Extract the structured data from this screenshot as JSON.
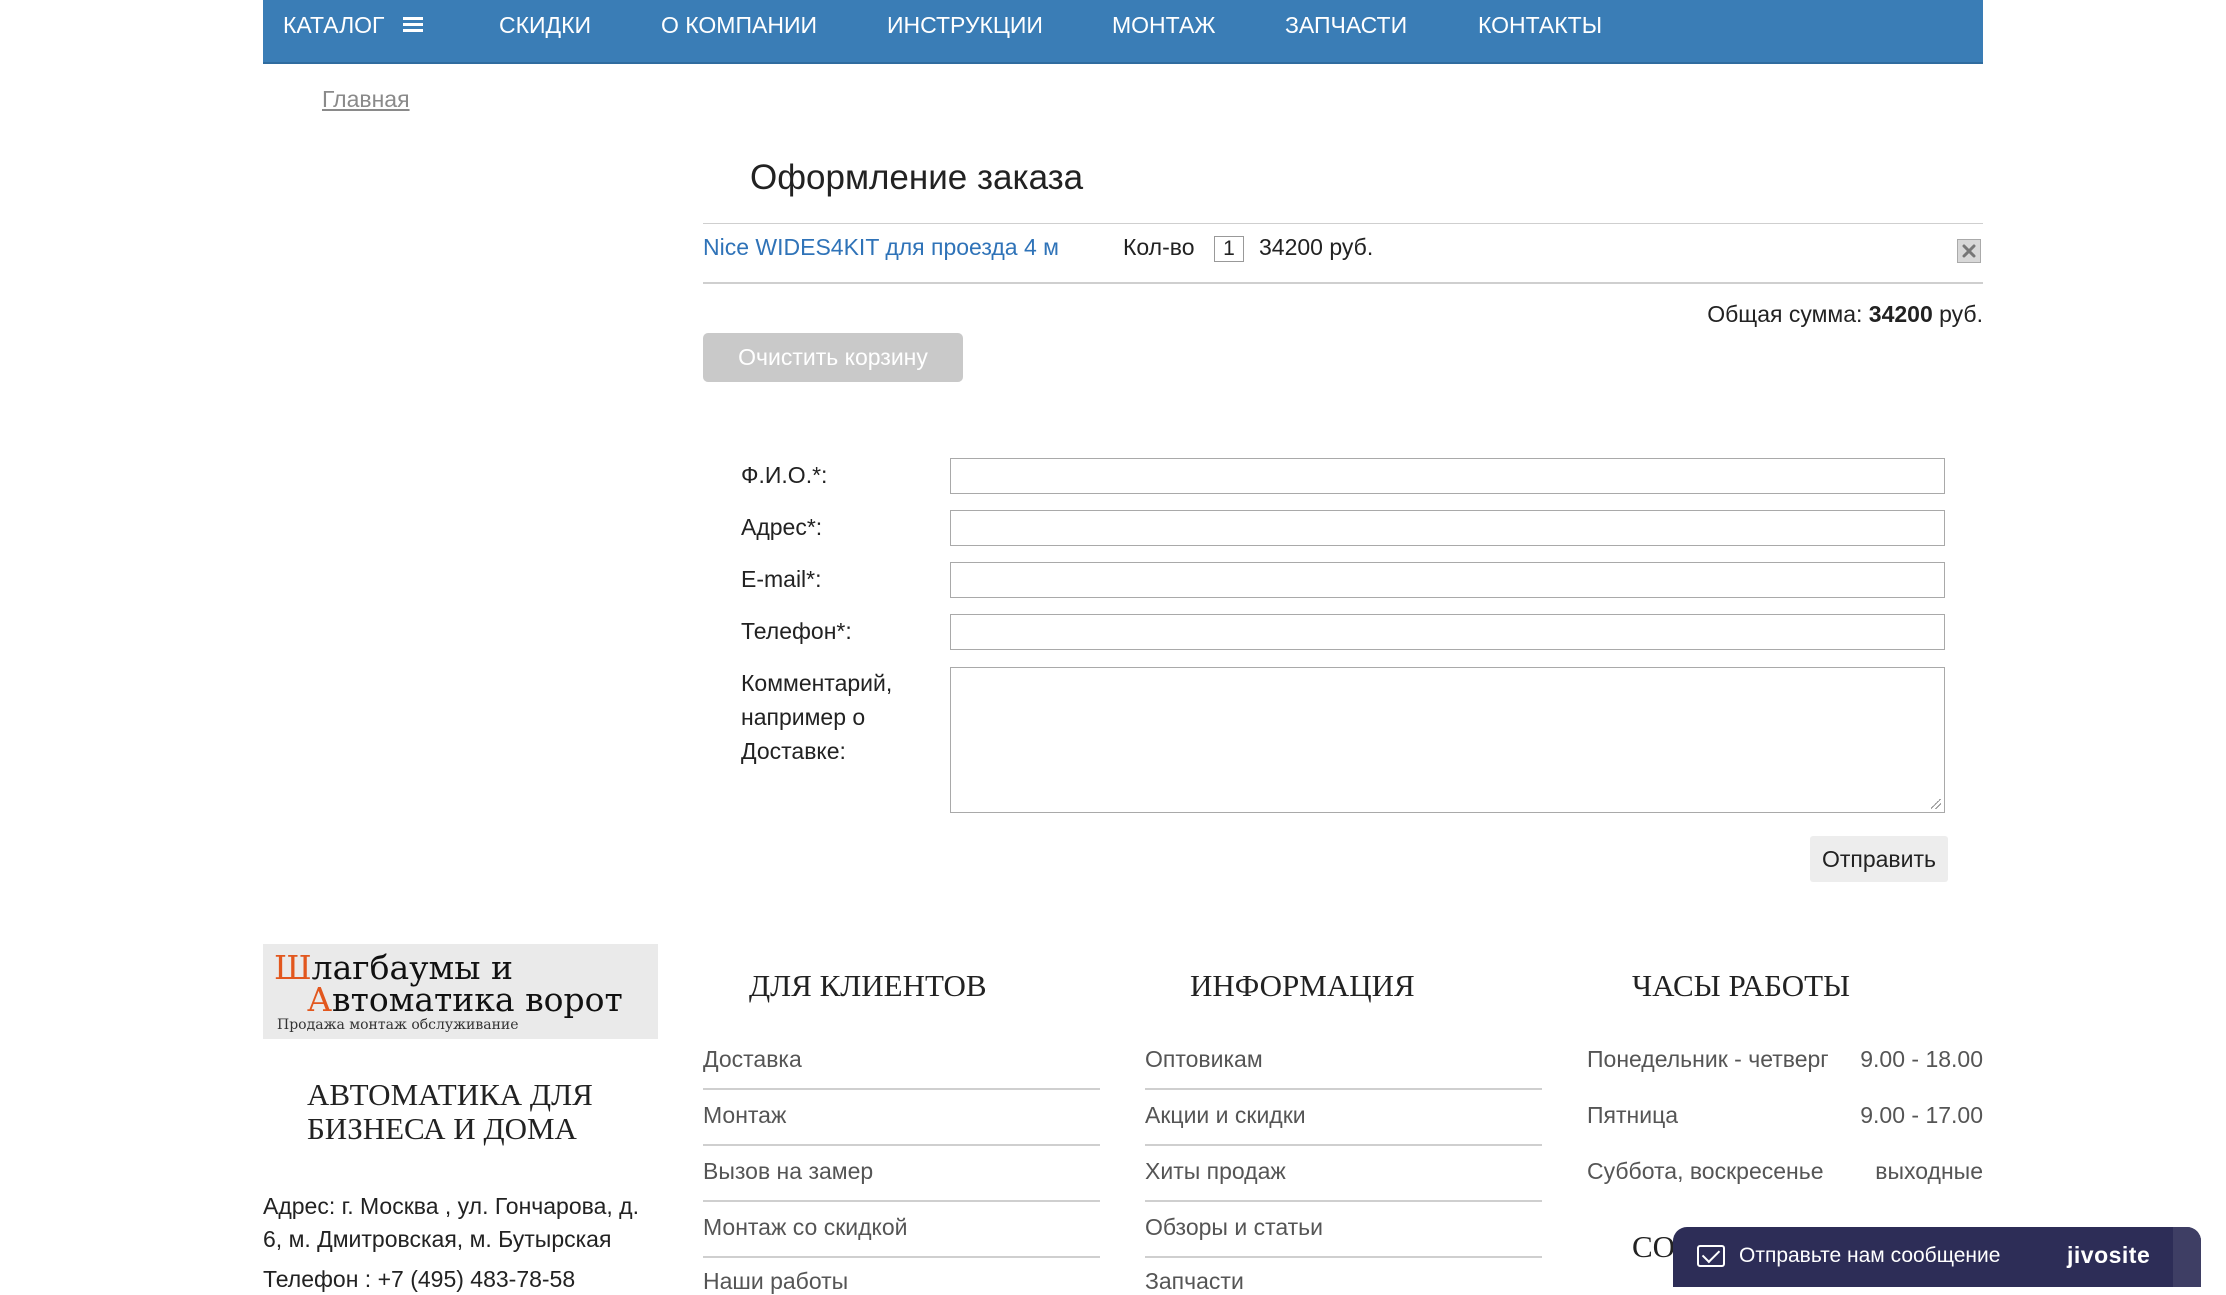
{
  "nav": {
    "catalog": "КАТАЛОГ",
    "items": [
      "СКИДКИ",
      "О КОМПАНИИ",
      "ИНСТРУКЦИИ",
      "МОНТАЖ",
      "ЗАПЧАСТИ",
      "КОНТАКТЫ"
    ]
  },
  "breadcrumb": "Главная",
  "order": {
    "title": "Оформление заказа",
    "product": "Nice WIDES4KIT для проезда 4 м",
    "qty_label": "Кол-во",
    "qty": "1",
    "price": "34200 руб.",
    "total_label": "Общая сумма:",
    "total_value": "34200",
    "total_currency": "руб.",
    "clear_button": "Очистить корзину"
  },
  "form": {
    "name_label": "Ф.И.О.*:",
    "address_label": "Адрес*:",
    "email_label": "E-mail*:",
    "phone_label": "Телефон*:",
    "comment_label_1": "Комментарий,",
    "comment_label_2": "например о",
    "comment_label_3": "Доставке:",
    "submit": "Отправить"
  },
  "footer": {
    "logo": {
      "line1_first": "Ш",
      "line1_rest": "лагбаумы и",
      "line2_first": "А",
      "line2_rest": "втоматика ворот",
      "tagline": "Продажа монтаж обслуживание"
    },
    "slogan": "АВТОМАТИКА ДЛЯ БИЗНЕСА И ДОМА",
    "address": "Адрес: г. Москва , ул. Гончарова, д. 6, м. Дмитровская, м. Бутырская",
    "phone": "Телефон : +7 (495) 483-78-58",
    "clients": {
      "title": "ДЛЯ КЛИЕНТОВ",
      "links": [
        "Доставка",
        "Монтаж",
        "Вызов на замер",
        "Монтаж со скидкой",
        "Наши работы"
      ]
    },
    "info": {
      "title": "ИНФОРМАЦИЯ",
      "links": [
        "Оптовикам",
        "Акции и скидки",
        "Хиты продаж",
        "Обзоры и статьи",
        "Запчасти"
      ]
    },
    "hours": {
      "title": "ЧАСЫ РАБОТЫ",
      "rows": [
        {
          "day": "Понедельник - четверг",
          "time": "9.00 - 18.00"
        },
        {
          "day": "Пятница",
          "time": "9.00 - 17.00"
        },
        {
          "day": "Суббота, воскресенье",
          "time": "выходные"
        }
      ]
    },
    "contacts_title_partial": "СО"
  },
  "chat": {
    "text": "Отправьте нам сообщение",
    "brand": "jivosite"
  }
}
